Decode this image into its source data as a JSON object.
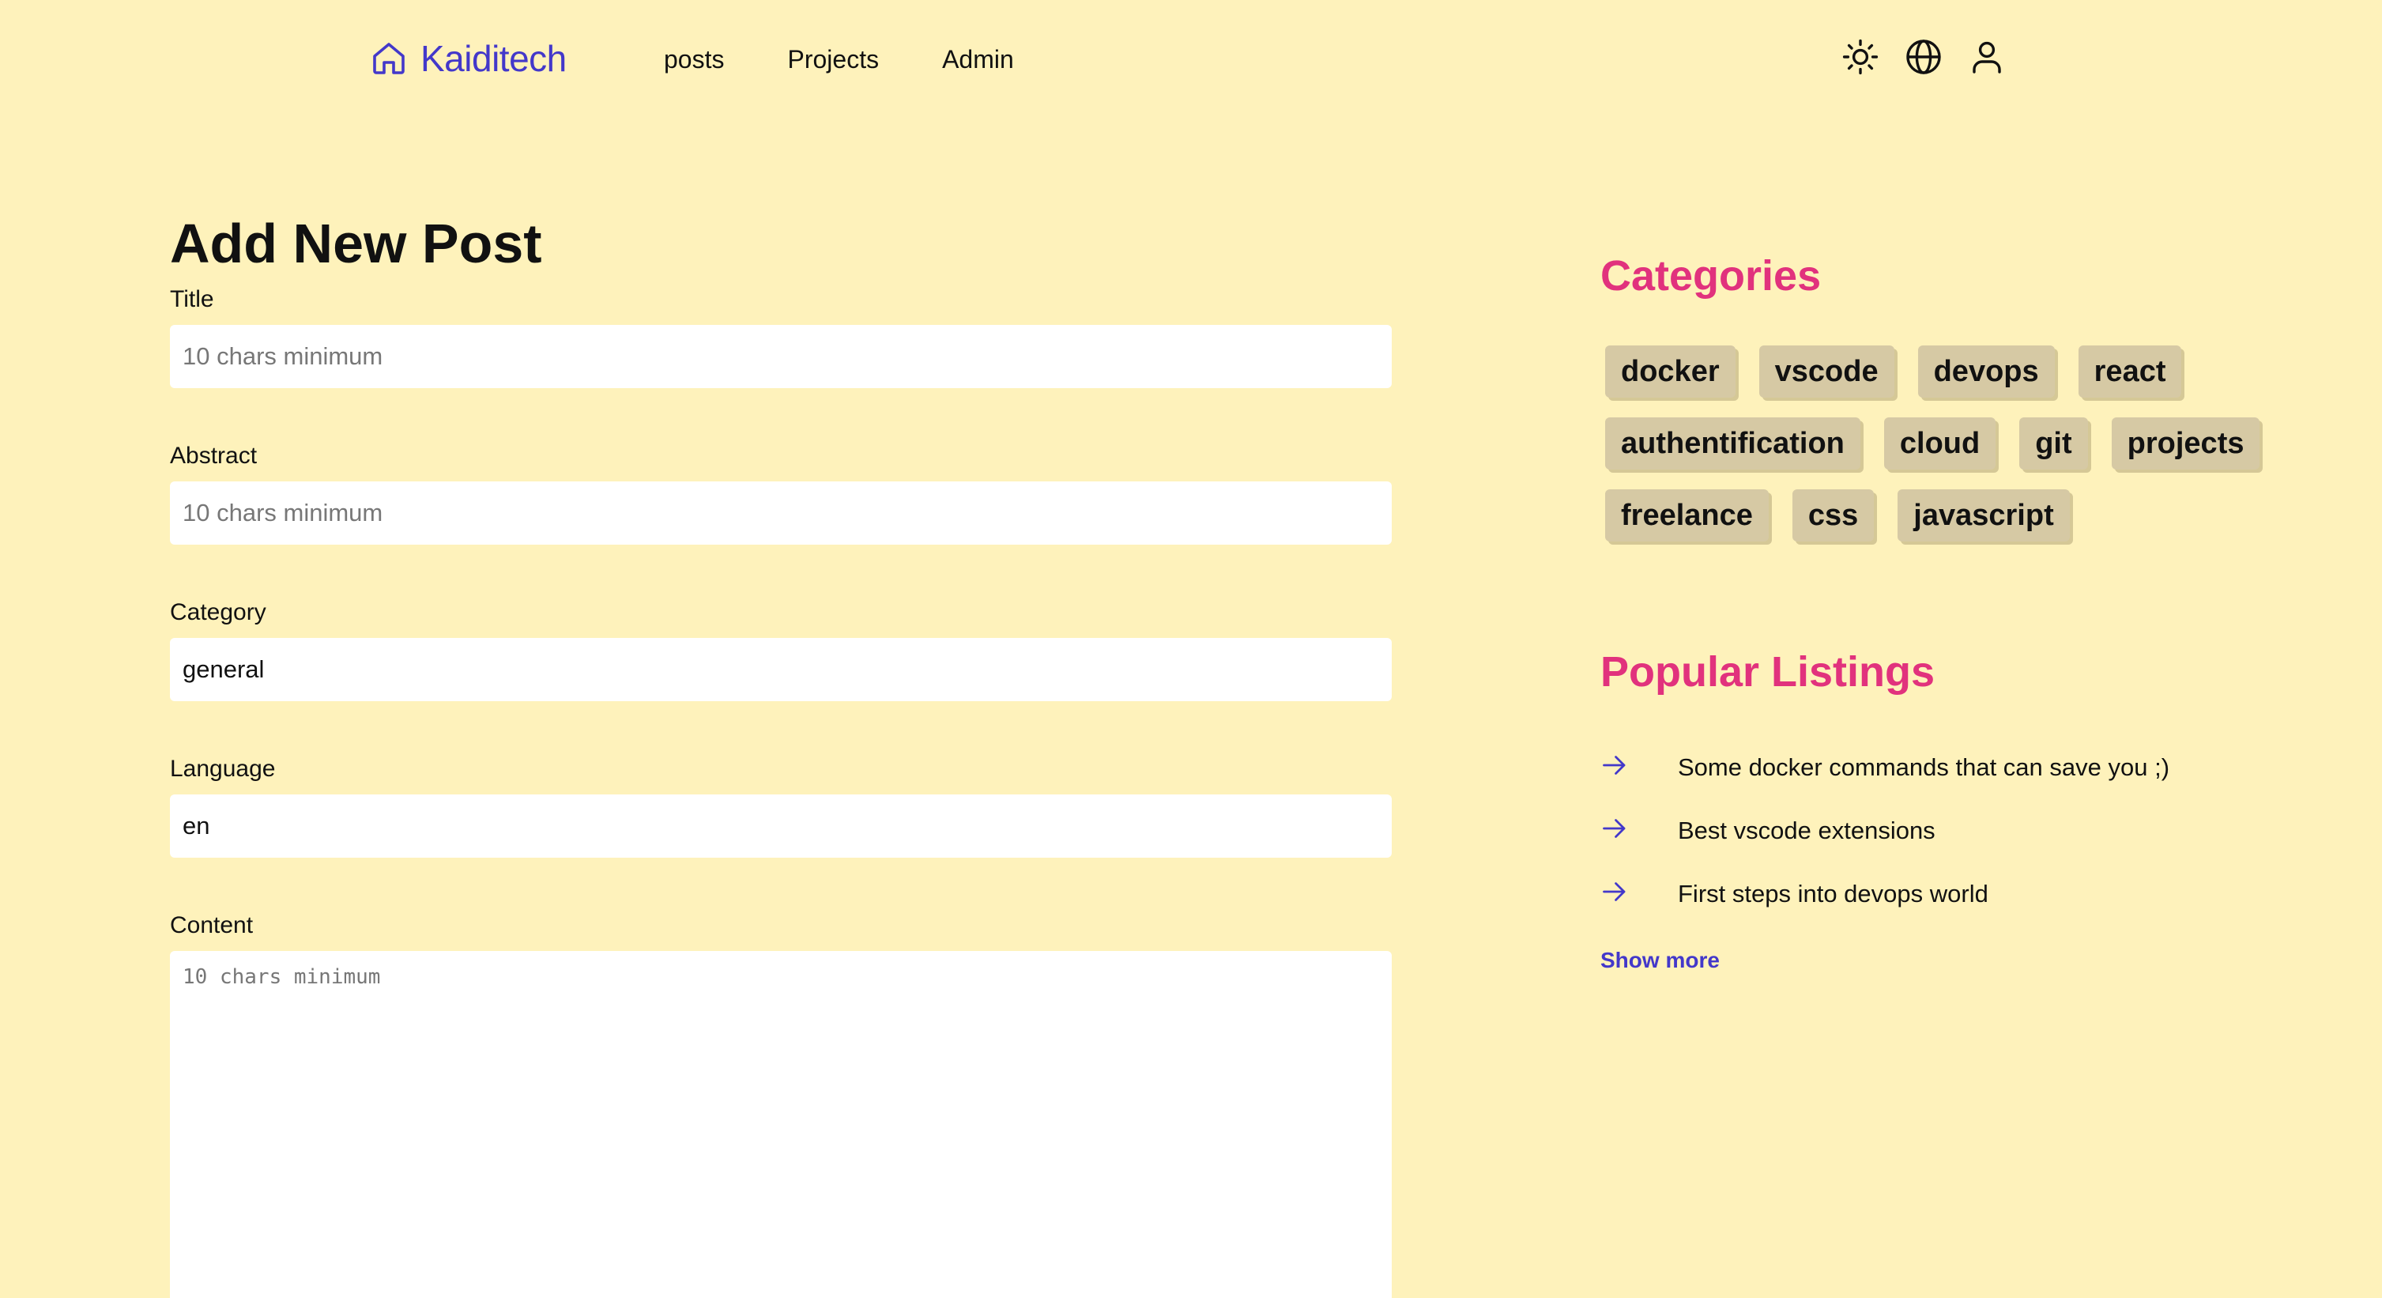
{
  "colors": {
    "background": "#FEF2BB",
    "brand": "#4338CA",
    "accent": "#E1327D",
    "tag_bg": "#D6C9A4",
    "input_bg": "#FFFFFF"
  },
  "header": {
    "brand_name": "Kaiditech",
    "brand_icon": "home-icon",
    "nav": [
      {
        "label": "posts"
      },
      {
        "label": "Projects"
      },
      {
        "label": "Admin"
      }
    ],
    "icons": [
      "sun-icon",
      "globe-icon",
      "user-icon"
    ]
  },
  "form": {
    "title": "Add New Post",
    "fields": {
      "title": {
        "label": "Title",
        "placeholder": "10 chars minimum",
        "value": ""
      },
      "abstract": {
        "label": "Abstract",
        "placeholder": "10 chars minimum",
        "value": ""
      },
      "category": {
        "label": "Category",
        "placeholder": "",
        "value": "general"
      },
      "language": {
        "label": "Language",
        "placeholder": "",
        "value": "en"
      },
      "content": {
        "label": "Content",
        "placeholder": "10 chars minimum",
        "value": ""
      }
    }
  },
  "sidebar": {
    "categories_title": "Categories",
    "categories": [
      "docker",
      "vscode",
      "devops",
      "react",
      "authentification",
      "cloud",
      "git",
      "projects",
      "freelance",
      "css",
      "javascript"
    ],
    "popular_title": "Popular Listings",
    "listings": [
      "Some docker commands that can save you ;)",
      "Best vscode extensions",
      "First steps into devops world"
    ],
    "listing_icon": "arrow-right-icon",
    "show_more": "Show more"
  }
}
